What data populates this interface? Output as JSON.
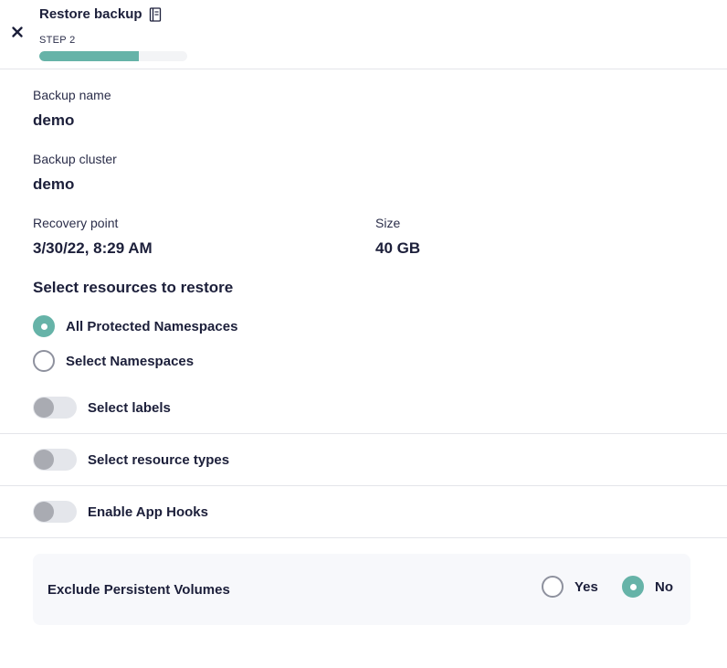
{
  "header": {
    "title": "Restore backup",
    "step": "STEP 2",
    "progress_fraction": 0.67
  },
  "details": {
    "backup_name_label": "Backup name",
    "backup_name_value": "demo",
    "backup_cluster_label": "Backup cluster",
    "backup_cluster_value": "demo",
    "recovery_point_label": "Recovery point",
    "recovery_point_value": "3/30/22, 8:29 AM",
    "size_label": "Size",
    "size_value": "40 GB"
  },
  "resources": {
    "title": "Select resources to restore",
    "options": [
      {
        "label": "All Protected Namespaces",
        "checked": true
      },
      {
        "label": "Select Namespaces",
        "checked": false
      }
    ]
  },
  "toggles": [
    {
      "label": "Select labels",
      "on": false
    },
    {
      "label": "Select resource types",
      "on": false
    },
    {
      "label": "Enable App Hooks",
      "on": false
    }
  ],
  "exclude": {
    "label": "Exclude Persistent Volumes",
    "yes_label": "Yes",
    "no_label": "No",
    "selected": "No"
  },
  "colors": {
    "accent": "#66b3a8",
    "text": "#1c1f3a",
    "divider": "#e4e5ea"
  }
}
